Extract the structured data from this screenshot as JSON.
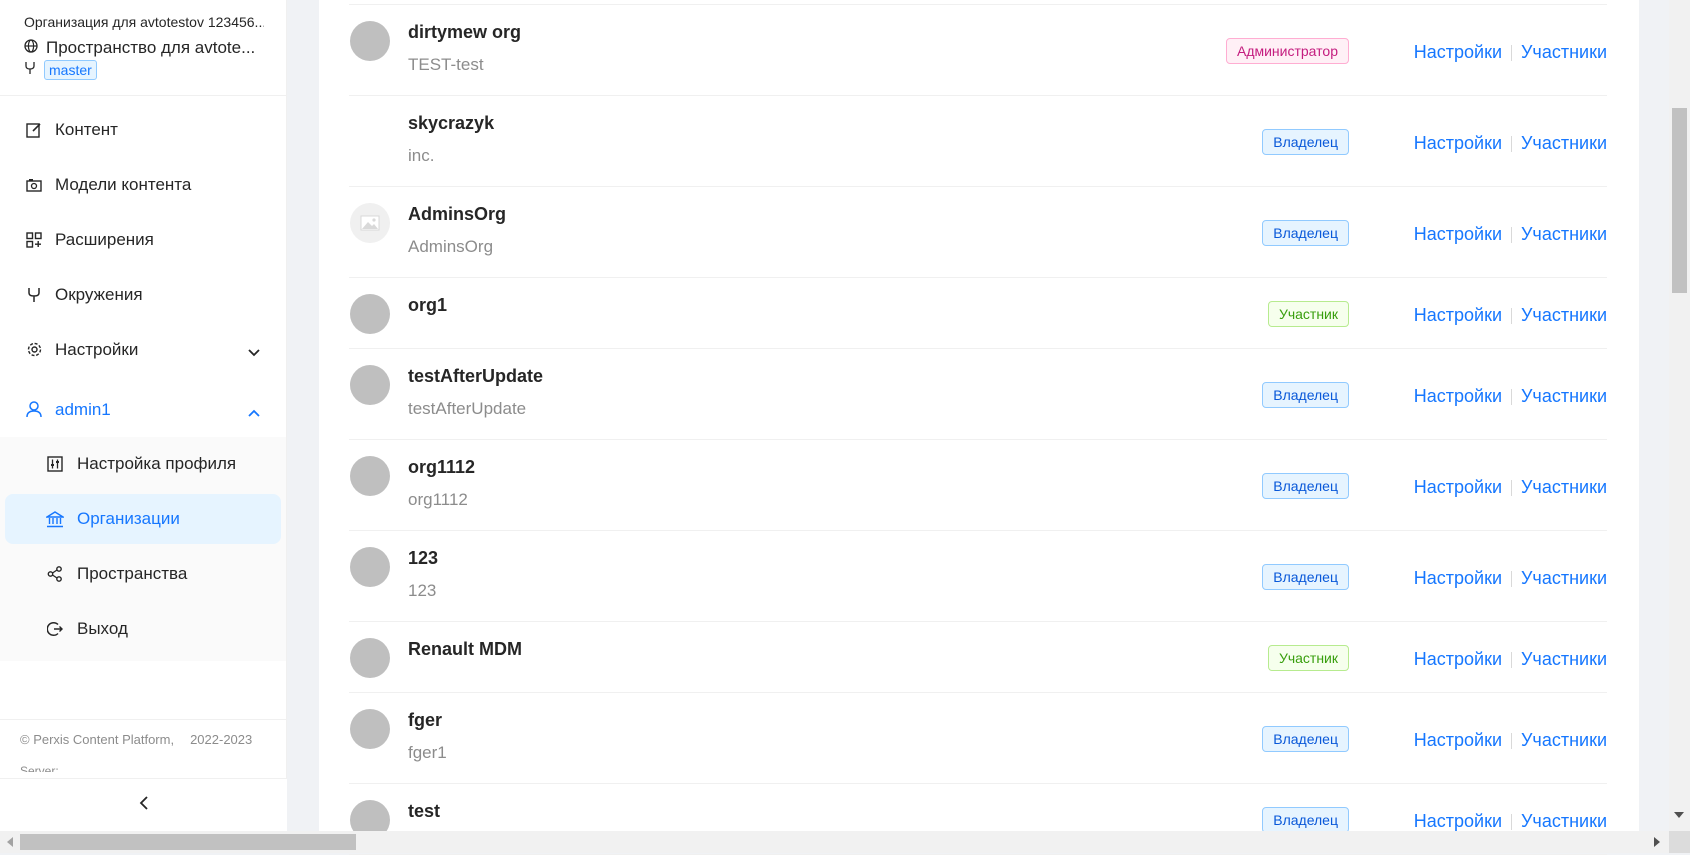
{
  "header": {
    "org_title": "Организация для avtotestov 123456...",
    "space_name": "Пространство для avtote...",
    "branch": "master"
  },
  "menu": {
    "content": "Контент",
    "content_models": "Модели контента",
    "extensions": "Расширения",
    "environments": "Окружения",
    "settings": "Настройки",
    "user": "admin1"
  },
  "submenu": {
    "profile": "Настройка профиля",
    "organizations": "Организации",
    "spaces": "Пространства",
    "logout": "Выход"
  },
  "footer": {
    "copyright": "© Perxis Content Platform,",
    "years": "2022-2023",
    "server": "Server:"
  },
  "actions": {
    "settings": "Настройки",
    "members": "Участники"
  },
  "organizations": [
    {
      "name": "dirtymew org",
      "description": "TEST-test",
      "role": "Администратор"
    },
    {
      "name": "skycrazyk",
      "description": "inc.",
      "role": "Владелец"
    },
    {
      "name": "AdminsOrg",
      "description": "AdminsOrg",
      "role": "Владелец"
    },
    {
      "name": "org1",
      "description": "",
      "role": "Участник"
    },
    {
      "name": "testAfterUpdate",
      "description": "testAfterUpdate",
      "role": "Владелец"
    },
    {
      "name": "org1112",
      "description": "org1112",
      "role": "Владелец"
    },
    {
      "name": "123",
      "description": "123",
      "role": "Владелец"
    },
    {
      "name": "Renault MDM",
      "description": "",
      "role": "Участник"
    },
    {
      "name": "fger",
      "description": "fger1",
      "role": "Владелец"
    },
    {
      "name": "test",
      "description": "",
      "role": "Владелец"
    }
  ]
}
